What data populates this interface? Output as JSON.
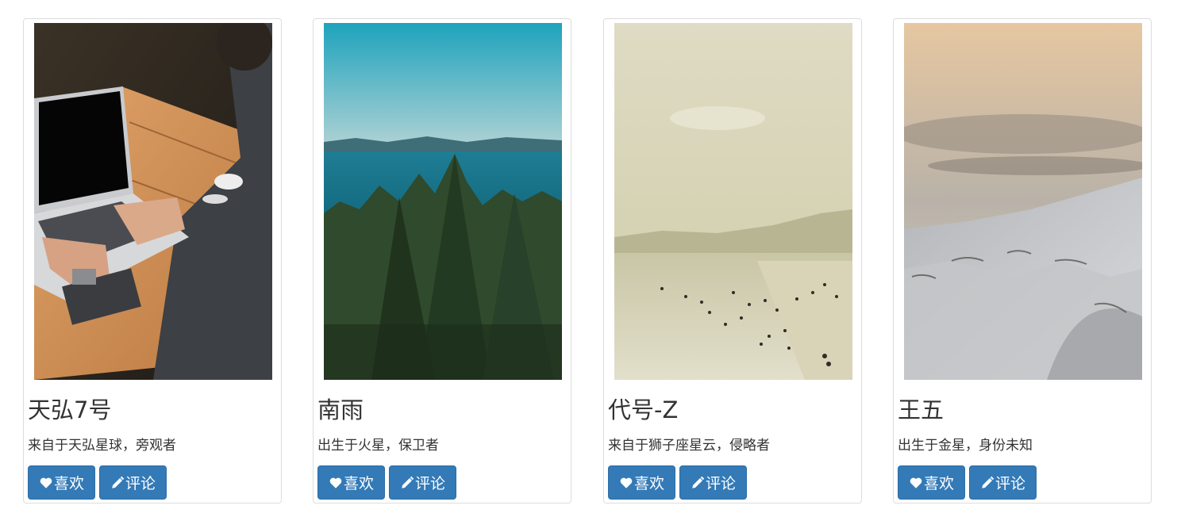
{
  "cards": [
    {
      "title": "天弘7号",
      "description": "来自于天弘星球，旁观者",
      "like_label": "喜欢",
      "comment_label": "评论",
      "image": "laptop-on-wooden-table-photo"
    },
    {
      "title": "南雨",
      "description": "出生于火星，保卫者",
      "like_label": "喜欢",
      "comment_label": "评论",
      "image": "forest-and-sea-photo"
    },
    {
      "title": "代号-Z",
      "description": "来自于狮子座星云，侵略者",
      "like_label": "喜欢",
      "comment_label": "评论",
      "image": "hazy-beach-photo"
    },
    {
      "title": "王五",
      "description": "出生于金星，身份未知",
      "like_label": "喜欢",
      "comment_label": "评论",
      "image": "snowy-mountain-photo"
    }
  ],
  "icons": {
    "like": "heart-icon",
    "comment": "pencil-icon"
  },
  "colors": {
    "button": "#337ab7",
    "card_border": "#dddddd",
    "text": "#333333"
  }
}
